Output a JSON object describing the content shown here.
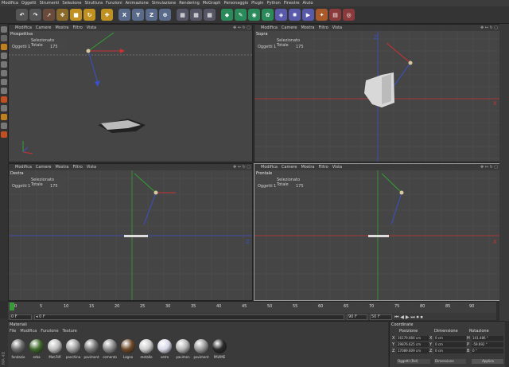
{
  "menubar": [
    "Modifica",
    "Oggetti",
    "Strumenti",
    "Selezione",
    "Struttura",
    "Funzioni",
    "Animazione",
    "Simulazione",
    "Rendering",
    "MoGraph",
    "Personaggio",
    "Plugin",
    "Python",
    "Finestre",
    "Aiuto"
  ],
  "toolbar": {
    "axis_x": "X",
    "axis_y": "Y",
    "axis_z": "Z"
  },
  "viewport_menu": [
    "Modifica",
    "Camere",
    "Mostra",
    "Filtro",
    "Vista"
  ],
  "viewports": [
    {
      "name": "Prospettiva",
      "hud_title": "Selezionato Totale",
      "hud_label": "Oggetti",
      "hud_sel": "1",
      "hud_total": "175"
    },
    {
      "name": "Sopra",
      "hud_title": "Selezionato Totale",
      "hud_label": "Oggetti",
      "hud_sel": "1",
      "hud_total": "175"
    },
    {
      "name": "Destra",
      "hud_title": "Selezionato Totale",
      "hud_label": "Oggetti",
      "hud_sel": "1",
      "hud_total": "175"
    },
    {
      "name": "Frontale",
      "hud_title": "Selezionato Totale",
      "hud_label": "Oggetti",
      "hud_sel": "1",
      "hud_total": "175"
    }
  ],
  "timeline": {
    "ticks": [
      "0",
      "5",
      "10",
      "15",
      "20",
      "25",
      "30",
      "35",
      "40",
      "45",
      "50",
      "55",
      "60",
      "65",
      "70",
      "75",
      "80",
      "85",
      "90"
    ],
    "start_frame": "0 F",
    "current_frame": "0 F",
    "end_frame": "90 F",
    "end_frame2": "50 F"
  },
  "materials": {
    "title": "Materiali",
    "menu": [
      "File",
      "Modifica",
      "Funzione",
      "Texture"
    ],
    "items": [
      {
        "label": "fondazio",
        "color": "#6b6b6b"
      },
      {
        "label": "erba",
        "color": "#3f6a2a"
      },
      {
        "label": "Mat.Rifl",
        "color": "#bdbdbd"
      },
      {
        "label": "panchina",
        "color": "#a0a0a0"
      },
      {
        "label": "paviment",
        "color": "#7a7a7a"
      },
      {
        "label": "cemento",
        "color": "#8c8c8c"
      },
      {
        "label": "Legno",
        "color": "#6e4a2a"
      },
      {
        "label": "metallo",
        "color": "#cccccc"
      },
      {
        "label": "vetro",
        "color": "#d8d8e8"
      },
      {
        "label": "pavimen",
        "color": "#b5b5b5"
      },
      {
        "label": "paviment",
        "color": "#9a9a9a"
      },
      {
        "label": "PAVIME",
        "color": "#2a2a2a"
      }
    ]
  },
  "coords": {
    "title": "Coordinate",
    "col_pos": "Posizione",
    "col_dim": "Dimensione",
    "col_rot": "Rotazione",
    "x_pos": "16179.666 cm",
    "x_dim": "0 cm",
    "x_rot": "141.486 °",
    "y_pos": "29876.625 cm",
    "y_dim": "0 cm",
    "y_rot": "-59.692 °",
    "z_pos": "17089.609 cm",
    "z_dim": "0 cm",
    "z_rot": "0 °",
    "ax_x": "X",
    "ax_y": "Y",
    "ax_z": "Z",
    "ax_h": "H",
    "ax_p": "P",
    "ax_b": "B",
    "mode": "Oggetti (Rel)",
    "dim_mode": "Dimensione",
    "apply": "Applica"
  },
  "app_label": "MA 4D",
  "colors": {
    "grid": "#505050",
    "bg": "#454545",
    "x_axis": "#c83232",
    "y_axis": "#32a032",
    "z_axis": "#3c50c8"
  }
}
